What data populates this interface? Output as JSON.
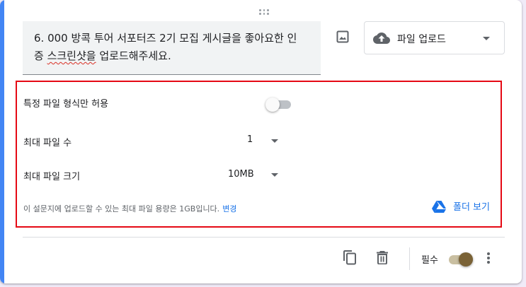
{
  "question": {
    "line1": "6. 000 방콕 투어 서포터즈 2기 모집 게시글을 좋아요한 인",
    "line2_pre": "증 ",
    "line2_sq": "스크린샷을",
    "line2_post": " 업로드해주세요."
  },
  "type_select": {
    "label": "파일 업로드",
    "icon": "cloud-upload-icon"
  },
  "settings": {
    "allow_specific_label": "특정 파일 형식만 허용",
    "allow_specific_on": false,
    "max_files_label": "최대 파일 수",
    "max_files_value": "1",
    "max_size_label": "최대 파일 크기",
    "max_size_value": "10MB",
    "note": "이 설문지에 업로드할 수 있는 최대 파일 용량은 1GB입니다.",
    "note_link": "변경",
    "folder_link": "폴더 보기"
  },
  "footer": {
    "required_label": "필수",
    "required_on": true
  },
  "colors": {
    "accent": "#4285f4",
    "highlight_box": "#e50914",
    "link": "#1a73e8",
    "toggle_on": "#7a6236"
  }
}
